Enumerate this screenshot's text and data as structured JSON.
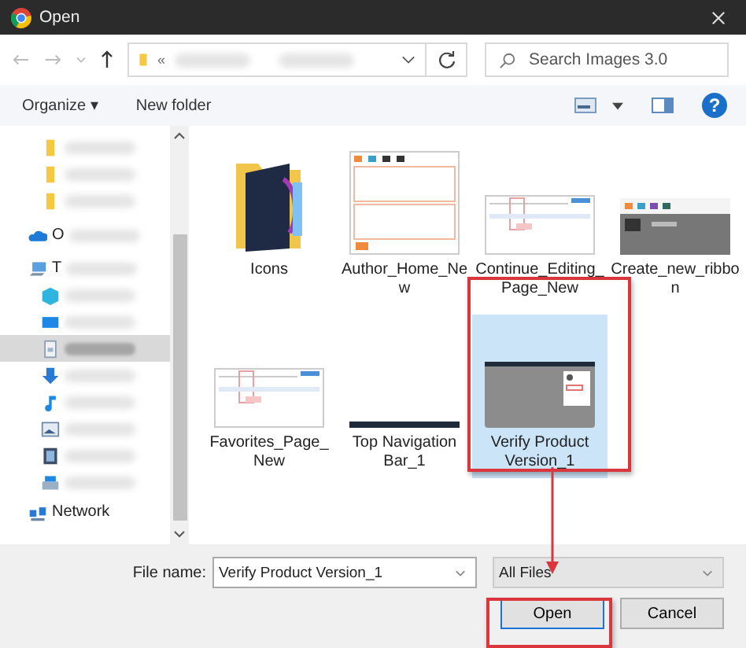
{
  "window": {
    "title": "Open"
  },
  "address": {
    "prefix": "«"
  },
  "search": {
    "placeholder": "Search Images 3.0"
  },
  "toolbar": {
    "organize": "Organize ▾",
    "new_folder": "New folder",
    "help": "?"
  },
  "sidebar": {
    "items": [
      {
        "kind": "folder",
        "selected": false
      },
      {
        "kind": "folder",
        "selected": false
      },
      {
        "kind": "folder",
        "selected": false
      },
      {
        "kind": "cloud",
        "label": "O",
        "selected": false
      },
      {
        "kind": "pc",
        "label": "T",
        "selected": false
      },
      {
        "kind": "cube",
        "selected": false
      },
      {
        "kind": "desktop",
        "selected": false
      },
      {
        "kind": "document",
        "selected": true
      },
      {
        "kind": "download",
        "selected": false
      },
      {
        "kind": "music",
        "selected": false
      },
      {
        "kind": "pictures",
        "selected": false
      },
      {
        "kind": "video",
        "selected": false
      },
      {
        "kind": "drive",
        "selected": false
      }
    ],
    "network": "Network"
  },
  "files": [
    {
      "name": "Icons",
      "kind": "folder",
      "selected": false
    },
    {
      "name": "Author_Home_New",
      "kind": "page-light",
      "selected": false
    },
    {
      "name": "Continue_Editing_Page_New",
      "kind": "page-wide",
      "selected": false
    },
    {
      "name": "Create_new_ribbon",
      "kind": "page-dark",
      "selected": false
    },
    {
      "name": "Favorites_Page_New",
      "kind": "page-wide",
      "selected": false
    },
    {
      "name": "Top Navigation Bar_1",
      "kind": "bar",
      "selected": false
    },
    {
      "name": "Verify Product Version_1",
      "kind": "dialog",
      "selected": true
    }
  ],
  "footer": {
    "file_name_label": "File name:",
    "file_name": "Verify Product Version_1",
    "file_type": "All Files",
    "open": "Open",
    "cancel": "Cancel"
  }
}
